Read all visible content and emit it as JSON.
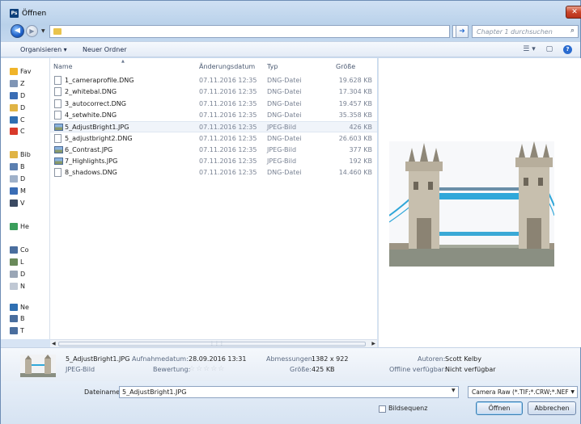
{
  "window": {
    "title": "Öffnen",
    "app_icon": "Ps"
  },
  "navigation": {
    "search_placeholder": "Chapter 1 durchsuchen"
  },
  "toolbar": {
    "organize": "Organisieren ▾",
    "new_folder": "Neuer Ordner"
  },
  "sidebar": {
    "items": [
      {
        "label": "Fav",
        "icon": "star-icon",
        "color": "#f0b429"
      },
      {
        "label": "Z",
        "icon": "downloads-icon",
        "color": "#7f95b5"
      },
      {
        "label": "D",
        "icon": "desktop-icon",
        "color": "#3a6db5"
      },
      {
        "label": "D",
        "icon": "documents-icon",
        "color": "#e0b445"
      },
      {
        "label": "C",
        "icon": "creative-cloud-icon",
        "color": "#2f6fb2"
      },
      {
        "label": "C",
        "icon": "creative-cloud-files-icon",
        "color": "#d93a2b"
      },
      {
        "label": "Bib",
        "icon": "libraries-icon",
        "color": "#e0b445"
      },
      {
        "label": "B",
        "icon": "pictures-icon",
        "color": "#5b7fb0"
      },
      {
        "label": "D",
        "icon": "documents-lib-icon",
        "color": "#9fb1c9"
      },
      {
        "label": "M",
        "icon": "music-icon",
        "color": "#3a6db5"
      },
      {
        "label": "V",
        "icon": "videos-icon",
        "color": "#3b4a62"
      },
      {
        "label": "He",
        "icon": "homegroup-icon",
        "color": "#3a9e5b"
      },
      {
        "label": "Co",
        "icon": "computer-icon",
        "color": "#4a6e9e"
      },
      {
        "label": "L",
        "icon": "local-disk-icon",
        "color": "#6a8a5a"
      },
      {
        "label": "D",
        "icon": "drive-icon",
        "color": "#9aa6b6"
      },
      {
        "label": "N",
        "icon": "network-drive-icon",
        "color": "#c0c8d4"
      },
      {
        "label": "Ne",
        "icon": "network-icon",
        "color": "#2f6fb2"
      },
      {
        "label": "B",
        "icon": "network-computer-icon",
        "color": "#4a6e9e"
      },
      {
        "label": "T",
        "icon": "network-computer-icon",
        "color": "#4a6e9e"
      }
    ]
  },
  "columns": {
    "name": "Name",
    "date": "Änderungsdatum",
    "type": "Typ",
    "size": "Größe"
  },
  "files": [
    {
      "name": "1_cameraprofile.DNG",
      "date": "07.11.2016 12:35",
      "type": "DNG-Datei",
      "size": "19.628 KB",
      "kind": "dng"
    },
    {
      "name": "2_whitebal.DNG",
      "date": "07.11.2016 12:35",
      "type": "DNG-Datei",
      "size": "17.304 KB",
      "kind": "dng"
    },
    {
      "name": "3_autocorrect.DNG",
      "date": "07.11.2016 12:35",
      "type": "DNG-Datei",
      "size": "19.457 KB",
      "kind": "dng"
    },
    {
      "name": "4_setwhite.DNG",
      "date": "07.11.2016 12:35",
      "type": "DNG-Datei",
      "size": "35.358 KB",
      "kind": "dng"
    },
    {
      "name": "5_AdjustBright1.JPG",
      "date": "07.11.2016 12:35",
      "type": "JPEG-Bild",
      "size": "426 KB",
      "kind": "jpg",
      "selected": true
    },
    {
      "name": "5_adjustbright2.DNG",
      "date": "07.11.2016 12:35",
      "type": "DNG-Datei",
      "size": "26.603 KB",
      "kind": "dng"
    },
    {
      "name": "6_Contrast.JPG",
      "date": "07.11.2016 12:35",
      "type": "JPEG-Bild",
      "size": "377 KB",
      "kind": "jpg"
    },
    {
      "name": "7_Highlights.JPG",
      "date": "07.11.2016 12:35",
      "type": "JPEG-Bild",
      "size": "192 KB",
      "kind": "jpg"
    },
    {
      "name": "8_shadows.DNG",
      "date": "07.11.2016 12:35",
      "type": "DNG-Datei",
      "size": "14.460 KB",
      "kind": "dng"
    }
  ],
  "details": {
    "filename": "5_AdjustBright1.JPG",
    "filetype": "JPEG-Bild",
    "date_label": "Aufnahmedatum:",
    "date_value": "28.09.2016 13:31",
    "rating_label": "Bewertung:",
    "rating": "☆☆☆☆☆",
    "dims_label": "Abmessungen:",
    "dims_value": "1382 x 922",
    "size_label": "Größe:",
    "size_value": "425 KB",
    "authors_label": "Autoren:",
    "authors_value": "Scott Kelby",
    "offline_label": "Offline verfügbar:",
    "offline_value": "Nicht verfügbar"
  },
  "footer": {
    "filename_label": "Dateiname:",
    "filename_value": "5_AdjustBright1.JPG",
    "filter_value": "Camera Raw (*.TIF;*.CRW;*.NEF",
    "sequence_label": "Bildsequenz",
    "open_label": "Öffnen",
    "cancel_label": "Abbrechen"
  }
}
